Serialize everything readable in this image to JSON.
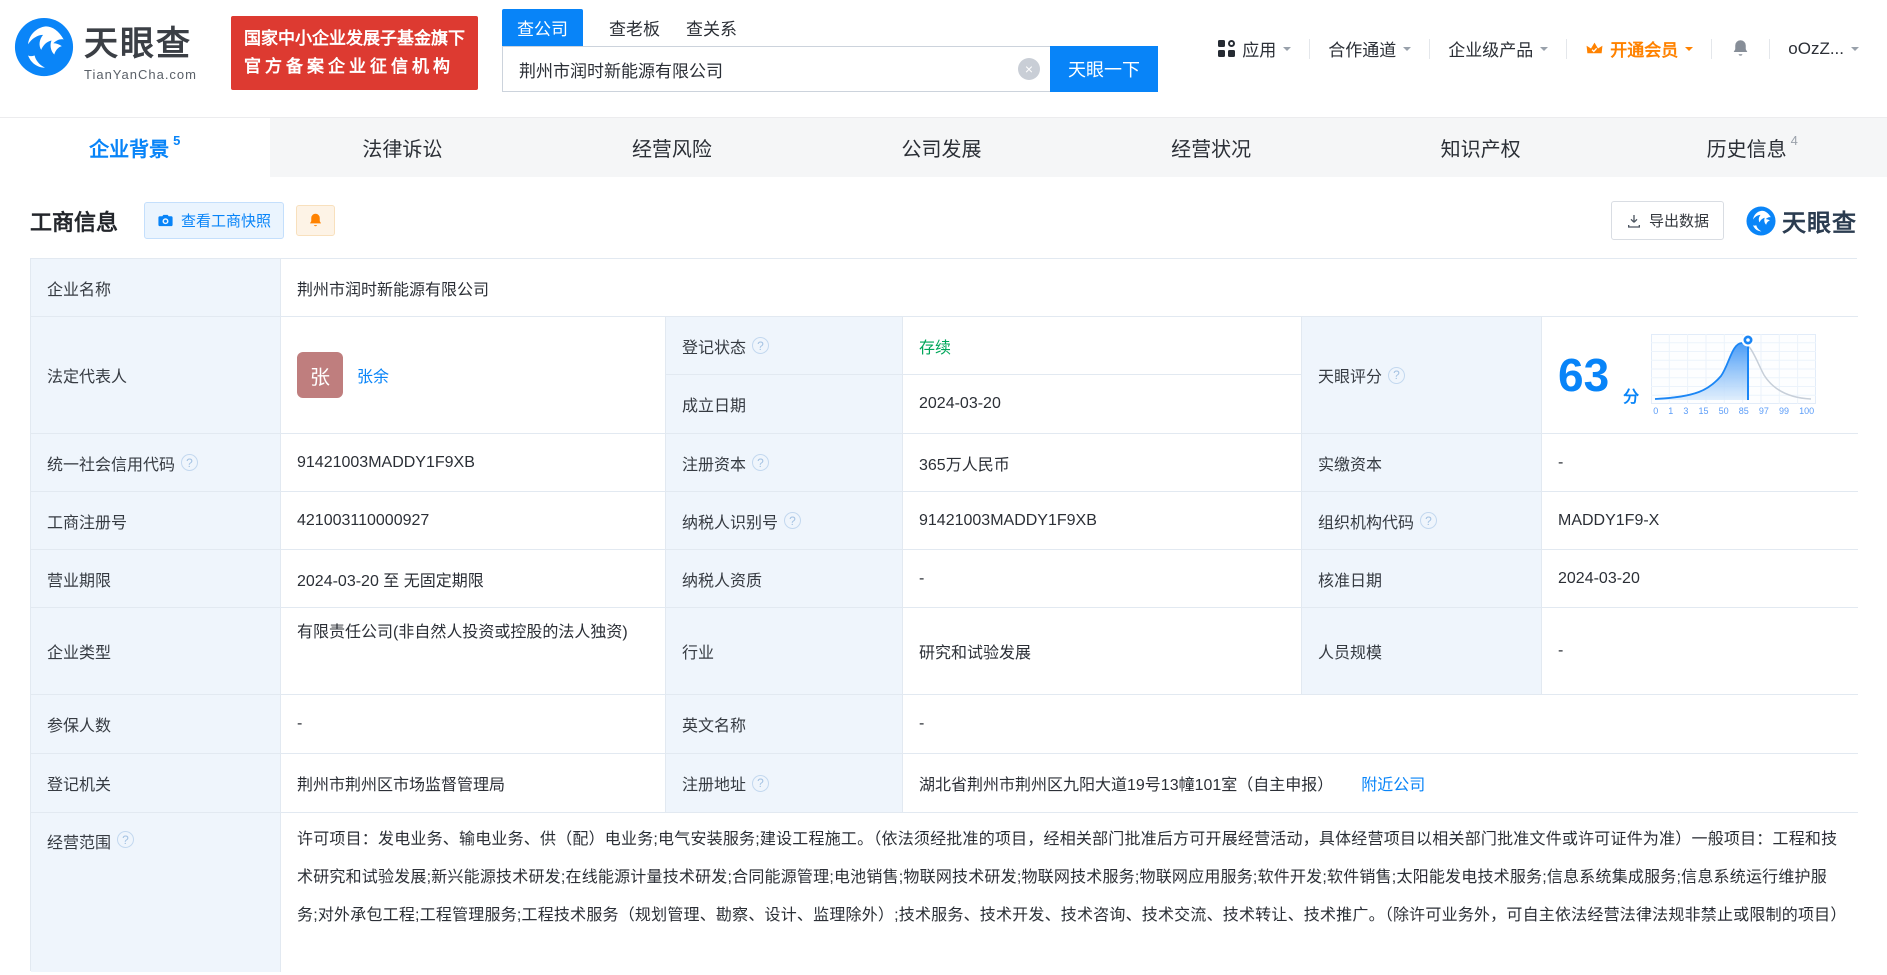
{
  "header": {
    "brand": "天眼查",
    "brand_domain": "TianYanCha.com",
    "badge": {
      "line1": "国家中小企业发展子基金旗下",
      "line2": "官方备案企业征信机构"
    },
    "search": {
      "tabs": [
        "查公司",
        "查老板",
        "查关系"
      ],
      "value": "荆州市润时新能源有限公司",
      "clear_glyph": "×",
      "button_label": "天眼一下"
    },
    "nav": {
      "apps": "应用",
      "partner": "合作通道",
      "enterprise": "企业级产品",
      "vip": "开通会员",
      "user": "oOzZ..."
    }
  },
  "tabs": [
    {
      "label": "企业背景",
      "count": "5"
    },
    {
      "label": "法律诉讼",
      "count": ""
    },
    {
      "label": "经营风险",
      "count": ""
    },
    {
      "label": "公司发展",
      "count": ""
    },
    {
      "label": "经营状况",
      "count": ""
    },
    {
      "label": "知识产权",
      "count": ""
    },
    {
      "label": "历史信息",
      "count": "4"
    }
  ],
  "toolbar": {
    "section_title": "工商信息",
    "snapshot_label": "查看工商快照",
    "export_label": "导出数据",
    "watermark_brand": "天眼查"
  },
  "icons": {
    "help_glyph": "?"
  },
  "info": {
    "company_name_label": "企业名称",
    "company_name": "荆州市润时新能源有限公司",
    "legal_rep_label": "法定代表人",
    "legal_rep_avatar": "张",
    "legal_rep_name": "张余",
    "reg_status_label": "登记状态",
    "reg_status": "存续",
    "establish_label": "成立日期",
    "establish_date": "2024-03-20",
    "score_label": "天眼评分",
    "insured_label": "参保人数",
    "insured_value": "-",
    "en_name_label": "英文名称",
    "en_name_value": "-",
    "registry_label": "登记机关",
    "registry_value": "荆州市荆州区市场监督管理局",
    "address_label": "注册地址",
    "address_value": "湖北省荆州市荆州区九阳大道19号13幢101室（自主申报）",
    "nearby_link": "附近公司",
    "scope_label": "经营范围",
    "scope_value": "许可项目：发电业务、输电业务、供（配）电业务;电气安装服务;建设工程施工。（依法须经批准的项目，经相关部门批准后方可开展经营活动，具体经营项目以相关部门批准文件或许可证件为准）一般项目：工程和技术研究和试验发展;新兴能源技术研发;在线能源计量技术研发;合同能源管理;电池销售;物联网技术研发;物联网技术服务;物联网应用服务;软件开发;软件销售;太阳能发电技术服务;信息系统集成服务;信息系统运行维护服务;对外承包工程;工程管理服务;工程技术服务（规划管理、勘察、设计、监理除外）;技术服务、技术开发、技术咨询、技术交流、技术转让、技术推广。（除许可业务外，可自主依法经营法律法规非禁止或限制的项目）"
  },
  "rows": [
    {
      "l1": "统一社会信用代码",
      "v1": "91421003MADDY1F9XB",
      "l2": "注册资本",
      "v2": "365万人民币",
      "l3": "实缴资本",
      "v3": "-"
    },
    {
      "l1": "工商注册号",
      "v1": "421003110000927",
      "l2": "纳税人识别号",
      "v2": "91421003MADDY1F9XB",
      "l3": "组织机构代码",
      "v3": "MADDY1F9-X"
    },
    {
      "l1": "营业期限",
      "v1": "2024-03-20 至 无固定期限",
      "l2": "纳税人资质",
      "v2": "-",
      "l3": "核准日期",
      "v3": "2024-03-20"
    },
    {
      "l1": "企业类型",
      "v1": "有限责任公司(非自然人投资或控股的法人独资)",
      "l2": "行业",
      "v2": "研究和试验发展",
      "l3": "人员规模",
      "v3": "-"
    }
  ],
  "score_chart": {
    "type": "line",
    "score": "63",
    "unit": "分",
    "ticks": [
      "0",
      "1",
      "3",
      "15",
      "50",
      "85",
      "97",
      "99",
      "100"
    ],
    "marker_pct": 59
  }
}
